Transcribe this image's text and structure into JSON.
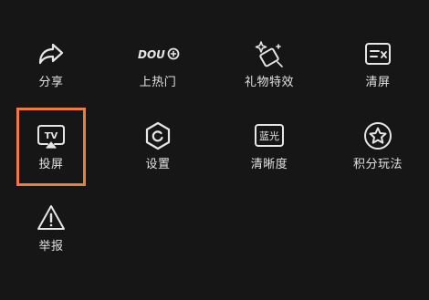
{
  "menu": {
    "items": [
      {
        "label": "分享",
        "icon": "share-arrow-icon"
      },
      {
        "label": "上热门",
        "icon": "dou-plus-icon",
        "icon_text": "DOU"
      },
      {
        "label": "礼物特效",
        "icon": "gift-sparkle-icon"
      },
      {
        "label": "清屏",
        "icon": "clear-screen-icon"
      },
      {
        "label": "投屏",
        "icon": "tv-cast-icon",
        "icon_text": "TV"
      },
      {
        "label": "设置",
        "icon": "settings-hexagon-icon"
      },
      {
        "label": "清晰度",
        "icon": "resolution-icon",
        "icon_text": "蓝光"
      },
      {
        "label": "积分玩法",
        "icon": "star-points-icon"
      },
      {
        "label": "举报",
        "icon": "report-warning-icon"
      }
    ]
  },
  "colors": {
    "background": "#161616",
    "icon": "#e6e6e6",
    "label": "#e2e2e2",
    "highlight": "#f07b3f"
  }
}
